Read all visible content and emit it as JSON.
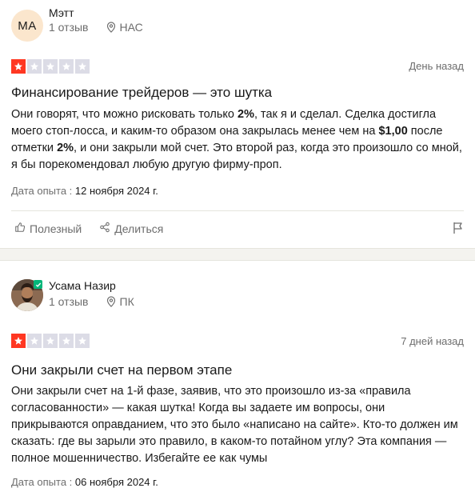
{
  "reviews": [
    {
      "author": {
        "initials": "MA",
        "name": "Мэтт",
        "reviews_count": "1 отзыв",
        "location": "НАС"
      },
      "rating": 1,
      "date": "День назад",
      "title": "Финансирование трейдеров — это шутка",
      "body": [
        {
          "t": "Они говорят, что можно рисковать только "
        },
        {
          "t": "2%",
          "b": true
        },
        {
          "t": ", так я и сделал. Сделка достигла моего стоп-лосса, и каким-то образом она закрылась менее чем на "
        },
        {
          "t": "$1,00",
          "b": true
        },
        {
          "t": " после отметки "
        },
        {
          "t": "2%",
          "b": true
        },
        {
          "t": ", и они закрыли мой счет. Это второй раз, когда это произошло со мной, я бы порекомендовал любую другую фирму-проп."
        }
      ],
      "experience_label": "Дата опыта :",
      "experience_date": "12 ноября 2024 г.",
      "actions": {
        "useful": "Полезный",
        "share": "Делиться"
      }
    },
    {
      "author": {
        "name": "Усама Назир",
        "reviews_count": "1 отзыв",
        "location": "ПК"
      },
      "rating": 1,
      "date": "7 дней назад",
      "title": "Они закрыли счет на первом этапе",
      "body": [
        {
          "t": "Они закрыли счет на 1-й фазе, заявив, что это произошло из-за «правила согласованности» — какая шутка! Когда вы задаете им вопросы, они прикрываются оправданием, что это было «написано на сайте». Кто-то должен им сказать: где вы зарыли это правило, в каком-то потайном углу? Эта компания — полное мошенничество. Избегайте ее как чумы"
        }
      ],
      "experience_label": "Дата опыта :",
      "experience_date": "06 ноября 2024 г."
    }
  ],
  "colors": {
    "star_filled": "#ff3722",
    "star_empty": "#dcdce6",
    "verified": "#04b67a",
    "avatar_bg": "#fbe6cd"
  }
}
